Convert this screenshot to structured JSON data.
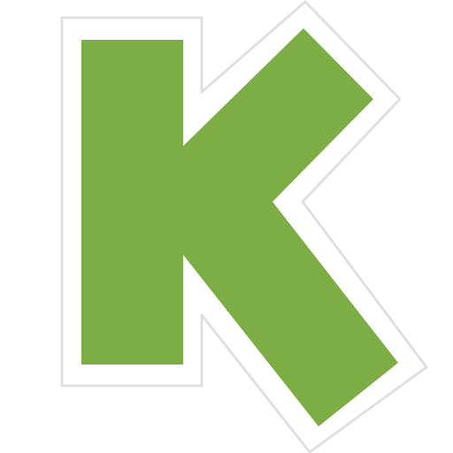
{
  "logo": {
    "letter": "K",
    "colors": {
      "fill": "#7cae45",
      "outline": "#e0e0e0",
      "inner_border": "#ffffff",
      "background": "#ffffff"
    }
  }
}
